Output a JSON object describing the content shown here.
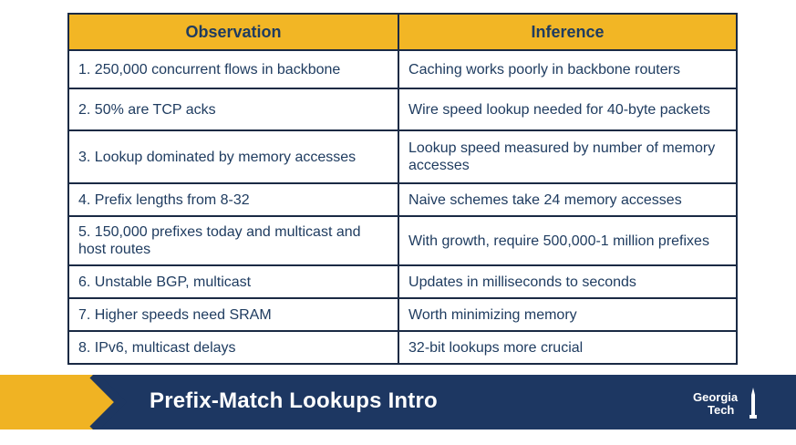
{
  "table": {
    "headers": {
      "observation": "Observation",
      "inference": "Inference"
    },
    "rows": [
      {
        "observation": "1. 250,000 concurrent flows in backbone",
        "inference": "Caching works poorly in backbone routers"
      },
      {
        "observation": "2. 50% are TCP acks",
        "inference": "Wire speed lookup needed for 40-byte packets"
      },
      {
        "observation": "3. Lookup dominated by memory accesses",
        "inference": "Lookup speed measured by number of memory accesses"
      },
      {
        "observation": "4. Prefix lengths from 8-32",
        "inference": "Naive schemes take 24 memory accesses"
      },
      {
        "observation": "5. 150,000 prefixes today and multicast and host routes",
        "inference": "With growth, require 500,000-1 million prefixes"
      },
      {
        "observation": "6. Unstable BGP, multicast",
        "inference": "Updates in milliseconds to seconds"
      },
      {
        "observation": "7. Higher speeds need SRAM",
        "inference": "Worth minimizing memory"
      },
      {
        "observation": "8. IPv6, multicast delays",
        "inference": "32-bit lookups more crucial"
      }
    ]
  },
  "footer": {
    "title": "Prefix-Match Lookups Intro",
    "logo_line1": "Georgia",
    "logo_line2": "Tech"
  },
  "colors": {
    "header_gold": "#f2b625",
    "footer_navy": "#1d3762",
    "text_navy": "#1f3c60"
  },
  "icons": [
    "chevron-right-icon",
    "tech-tower-icon"
  ]
}
